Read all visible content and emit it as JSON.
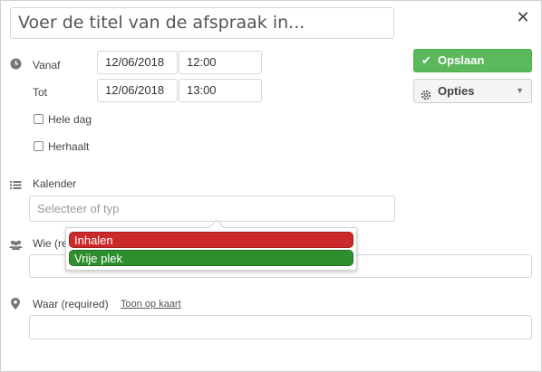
{
  "dialog": {
    "title_value": "Voer de titel van de afspraak in...",
    "close_glyph": "✕"
  },
  "time": {
    "from_label": "Vanaf",
    "to_label": "Tot",
    "from_date": "12/06/2018",
    "from_time": "12:00",
    "to_date": "12/06/2018",
    "to_time": "13:00"
  },
  "options": {
    "all_day_label": "Hele dag",
    "repeat_label": "Herhaalt"
  },
  "actions": {
    "save_label": "Opslaan",
    "options_label": "Opties"
  },
  "calendar": {
    "label": "Kalender",
    "placeholder": "Selecteer of typ",
    "dropdown_items": [
      {
        "label": "Inhalen",
        "color": "#cc2a2a"
      },
      {
        "label": "Vrije plek",
        "color": "#2f8f2f"
      }
    ]
  },
  "who": {
    "label": "Wie (re"
  },
  "where": {
    "label": "Waar (required)",
    "map_link": "Toon op kaart"
  },
  "colors": {
    "save_green": "#5cb85c",
    "text": "#444444"
  }
}
